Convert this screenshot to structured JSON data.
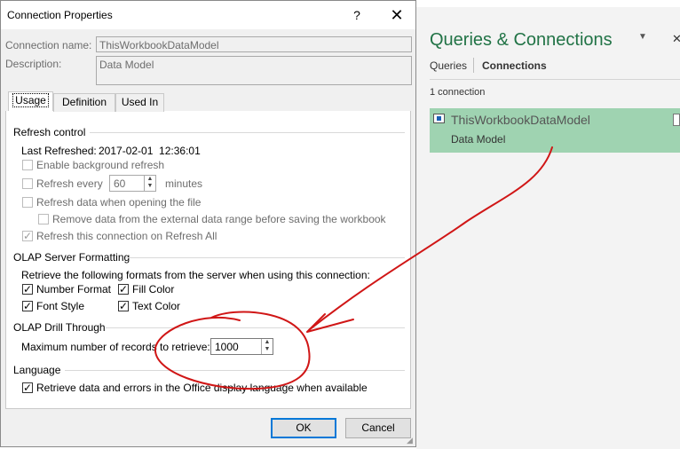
{
  "dialog": {
    "title": "Connection Properties",
    "help_glyph": "?",
    "close_glyph": "✕",
    "connection_name_label": "Connection name:",
    "connection_name_value": "ThisWorkbookDataModel",
    "description_label": "Description:",
    "description_value": "Data Model",
    "tabs": [
      {
        "label": "Usage",
        "active": true
      },
      {
        "label": "Definition",
        "active": false
      },
      {
        "label": "Used In",
        "active": false
      }
    ],
    "refresh_control": {
      "heading": "Refresh control",
      "last_refreshed_label": "Last Refreshed:",
      "last_refreshed_value": "2017-02-01  12:36:01",
      "enable_background": "Enable background refresh",
      "refresh_every": "Refresh every",
      "refresh_every_value": "60",
      "minutes": "minutes",
      "refresh_on_open": "Refresh data when opening the file",
      "remove_data": "Remove data from the external data range before saving the workbook",
      "refresh_on_all": "Refresh this connection on Refresh All"
    },
    "olap_formatting": {
      "heading": "OLAP Server Formatting",
      "description": "Retrieve the following formats from the server when using this connection:",
      "number_format": "Number Format",
      "fill_color": "Fill Color",
      "font_style": "Font Style",
      "text_color": "Text Color"
    },
    "olap_drill": {
      "heading": "OLAP Drill Through",
      "max_records_label": "Maximum number of records to retrieve:",
      "max_records_value": "1000"
    },
    "language": {
      "heading": "Language",
      "retrieve_label": "Retrieve data and errors in the Office display language when available"
    },
    "ok_label": "OK",
    "cancel_label": "Cancel"
  },
  "pane": {
    "title": "Queries & Connections",
    "menu_glyph": "▼",
    "close_glyph": "✕",
    "tab_queries": "Queries",
    "tab_connections": "Connections",
    "count": "1 connection",
    "item_name": "ThisWorkbookDataModel",
    "item_desc": "Data Model"
  },
  "colors": {
    "accent_green": "#217346",
    "selected_item": "#9fd3b1",
    "annotation_red": "#d01616"
  }
}
